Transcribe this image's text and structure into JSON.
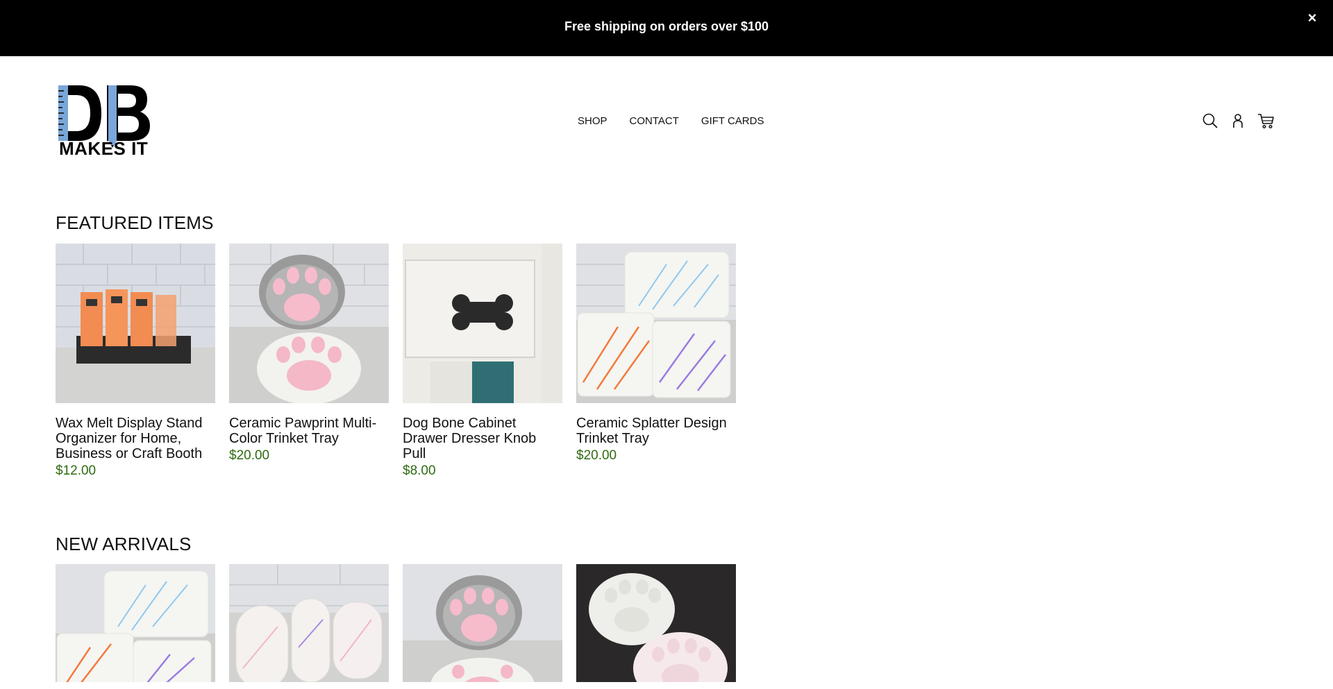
{
  "announcement": {
    "text": "Free shipping on orders over $100",
    "close_label": "×"
  },
  "brand": {
    "logo_text": "MAKES IT",
    "logo_letters": "DB"
  },
  "nav": {
    "items": [
      {
        "label": "SHOP"
      },
      {
        "label": "CONTACT"
      },
      {
        "label": "GIFT CARDS"
      }
    ]
  },
  "header_icons": [
    "search-icon",
    "account-icon",
    "cart-icon"
  ],
  "featured": {
    "title": "FEATURED ITEMS",
    "items": [
      {
        "name": "Wax Melt Display Stand Organizer for Home, Business or Craft Booth",
        "price": "$12.00",
        "image": "wax-melt-stand"
      },
      {
        "name": "Ceramic Pawprint Multi-Color Trinket Tray",
        "price": "$20.00",
        "image": "pawprint-trays"
      },
      {
        "name": "Dog Bone Cabinet Drawer Dresser Knob Pull",
        "price": "$8.00",
        "image": "dog-bone-knob"
      },
      {
        "name": "Ceramic Splatter Design Trinket Tray",
        "price": "$20.00",
        "image": "splatter-trays"
      }
    ]
  },
  "new_arrivals": {
    "title": "NEW ARRIVALS",
    "items": [
      {
        "image": "splatter-trays"
      },
      {
        "image": "oval-trays"
      },
      {
        "image": "pawprint-trays"
      },
      {
        "image": "white-paw-trays-dark"
      }
    ]
  },
  "colors": {
    "announcement_bg": "#000000",
    "price": "#2f6b12",
    "logo_blue": "#7aa6d9"
  }
}
